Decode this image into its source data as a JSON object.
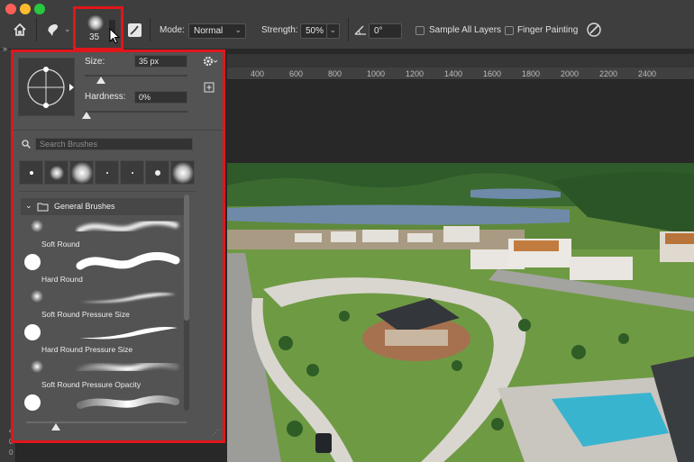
{
  "options_bar": {
    "brush_size": "35",
    "mode_label": "Mode:",
    "mode_value": "Normal",
    "strength_label": "Strength:",
    "strength_value": "50%",
    "angle_value": "0°",
    "sample_all_layers": "Sample All Layers",
    "finger_painting": "Finger Painting"
  },
  "ruler": {
    "ticks": [
      "400",
      "600",
      "800",
      "1000",
      "1200",
      "1400",
      "1600",
      "1800",
      "2000",
      "2200",
      "2400"
    ]
  },
  "brush_panel": {
    "size_label": "Size:",
    "size_value": "35 px",
    "hardness_label": "Hardness:",
    "hardness_value": "0%",
    "search_placeholder": "Search Brushes",
    "group_name": "General Brushes",
    "brushes": [
      "Soft Round",
      "Hard Round",
      "Soft Round Pressure Size",
      "Hard Round Pressure Size",
      "Soft Round Pressure Opacity"
    ]
  },
  "vertical_ruler": [
    "4",
    "0",
    "0"
  ],
  "colors": {
    "highlight": "#e0161b",
    "panel_bg": "#535353",
    "toolbar_bg": "#3e3e3e"
  }
}
